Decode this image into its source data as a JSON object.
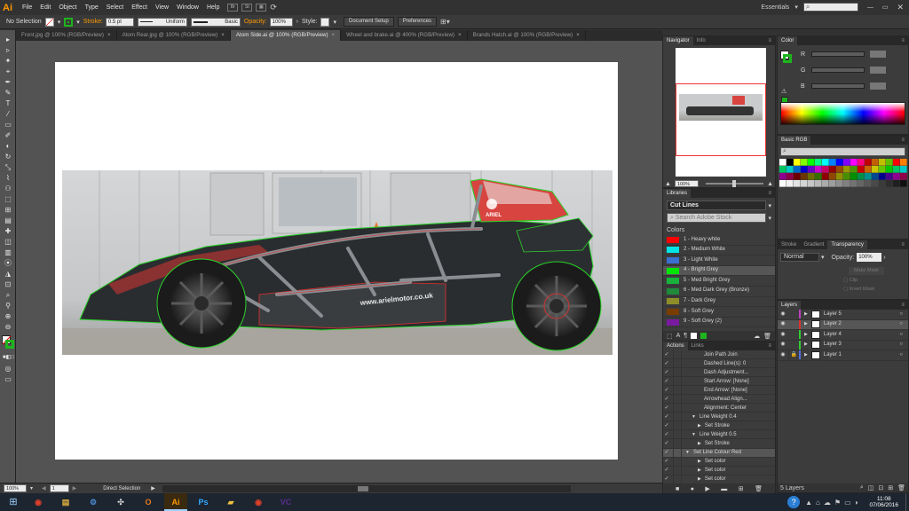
{
  "app": {
    "logo_text": "Ai",
    "menus": [
      "File",
      "Edit",
      "Object",
      "Type",
      "Select",
      "Effect",
      "View",
      "Window",
      "Help"
    ],
    "menu_box_1": "Br",
    "menu_box_2": "St",
    "workspace": "Essentials",
    "search_placeholder": ""
  },
  "control": {
    "selection": "No Selection",
    "stroke_label": "Stroke:",
    "stroke_value": "0.5 pt",
    "profile": "Uniform",
    "brush": "Basic",
    "opacity_label": "Opacity:",
    "opacity_value": "100%",
    "style_label": "Style:",
    "document_setup": "Document Setup",
    "preferences": "Preferences"
  },
  "tabs": [
    "Front.jpg @ 100% (RGB/Preview)",
    "Atom Rear.jpg @ 100% (RGB/Preview)",
    "Atom Side.ai @ 100% (RGB/Preview)",
    "Wheel and brake.ai @ 400% (RGB/Preview)",
    "Brands Hatch.ai @ 100% (RGB/Preview)"
  ],
  "active_tab": 2,
  "tools": [
    "▸",
    "▹",
    "✦",
    "⌖",
    "✒",
    "✎",
    "T",
    "⁄",
    "▭",
    "✐",
    "◐",
    "↻",
    "⤡",
    "⌇",
    "⚇",
    "⬚",
    "⊞",
    "▤",
    "✚",
    "◫",
    "▥",
    "⦿",
    "◮",
    "⊡",
    "⌕",
    "⚲",
    "⊕",
    "⊖"
  ],
  "status": {
    "zoom": "100%",
    "page": "1",
    "tool_name": "Direct Selection"
  },
  "navigator": {
    "tabs": [
      "Navigator",
      "Info"
    ],
    "zoom": "100%"
  },
  "color_panel": {
    "tab": "Color",
    "channels": [
      "R",
      "G",
      "B"
    ]
  },
  "libraries": {
    "tab": "Libraries",
    "library": "Cut Lines",
    "search_placeholder": "Search Adobe Stock",
    "section": "Colors",
    "colors": [
      {
        "name": "1 - Heavy white",
        "hex": "#ff0000"
      },
      {
        "name": "2 - Medium White",
        "hex": "#00e5e5"
      },
      {
        "name": "3 - Light White",
        "hex": "#3b6fd1"
      },
      {
        "name": "4 - Bright Grey",
        "hex": "#00e600"
      },
      {
        "name": "5 - Med Bright Grey",
        "hex": "#19b33c"
      },
      {
        "name": "6 - Med Dark Grey (Bronze)",
        "hex": "#1f8a3b"
      },
      {
        "name": "7 - Dark Grey",
        "hex": "#8d8d2a"
      },
      {
        "name": "8 - Soft Grey",
        "hex": "#7a3d00"
      },
      {
        "name": "9 - Soft Grey (2)",
        "hex": "#7a1aa0"
      }
    ],
    "selected_index": 3
  },
  "actions": {
    "tabs": [
      "Actions",
      "Links"
    ],
    "items": [
      {
        "label": "Join Path Join",
        "indent": 3,
        "arrow": ""
      },
      {
        "label": "Dashed Line(s): 0",
        "indent": 3,
        "arrow": ""
      },
      {
        "label": "Dash Adjustment...",
        "indent": 3,
        "arrow": ""
      },
      {
        "label": "Start Arrow: [None]",
        "indent": 3,
        "arrow": ""
      },
      {
        "label": "End Arrow: [None]",
        "indent": 3,
        "arrow": ""
      },
      {
        "label": "Arrowhead Align...",
        "indent": 3,
        "arrow": ""
      },
      {
        "label": "Alignment: Center",
        "indent": 3,
        "arrow": ""
      },
      {
        "label": "Line Weight 0.4",
        "indent": 1,
        "arrow": "▼"
      },
      {
        "label": "Set Stroke",
        "indent": 2,
        "arrow": "▶"
      },
      {
        "label": "Line Weight 0.5",
        "indent": 1,
        "arrow": "▼"
      },
      {
        "label": "Set Stroke",
        "indent": 2,
        "arrow": "▶"
      },
      {
        "label": "Set Line Colour Red",
        "indent": 0,
        "arrow": "▼"
      },
      {
        "label": "Set color",
        "indent": 2,
        "arrow": "▶"
      },
      {
        "label": "Set color",
        "indent": 2,
        "arrow": "▶"
      },
      {
        "label": "Set color",
        "indent": 2,
        "arrow": "▶"
      }
    ],
    "selected_index": 11
  },
  "swatches": {
    "tab": "Basic RGB"
  },
  "stroke_panel": {
    "tabs": [
      "Stroke",
      "Gradient",
      "Transparency"
    ],
    "blend_mode": "Normal",
    "opacity_label": "Opacity:",
    "opacity_value": "100%",
    "make_mask": "Make Mask",
    "clip": "Clip",
    "invert_mask": "Invert Mask"
  },
  "layers": {
    "tab": "Layers",
    "items": [
      {
        "name": "Layer 5",
        "color": "#c040c0",
        "locked": false
      },
      {
        "name": "Layer 2",
        "color": "#e03030",
        "locked": false
      },
      {
        "name": "Layer 4",
        "color": "#33cc33",
        "locked": false
      },
      {
        "name": "Layer 3",
        "color": "#33cc33",
        "locked": false
      },
      {
        "name": "Layer 1",
        "color": "#4f6fe0",
        "locked": true
      }
    ],
    "selected_index": 1,
    "count_label": "5 Layers"
  },
  "artwork": {
    "website": "www.arielmotor.co.uk",
    "badge": "ARIEL"
  },
  "taskbar": {
    "apps": [
      {
        "label": "◉",
        "color": "#e0402a"
      },
      {
        "label": "▤",
        "color": "#e0b040"
      },
      {
        "label": "⚙",
        "color": "#4a8ad0"
      },
      {
        "label": "✣",
        "color": "#cccccc"
      },
      {
        "label": "O",
        "color": "#e87a20"
      },
      {
        "label": "Ai",
        "color": "#ff9a00"
      },
      {
        "label": "Ps",
        "color": "#31a8ff"
      },
      {
        "label": "▰",
        "color": "#f0c040"
      },
      {
        "label": "◉",
        "color": "#e0402a"
      },
      {
        "label": "VC",
        "color": "#5c2d91"
      }
    ],
    "time": "11:08",
    "date": "07/06/2016"
  }
}
